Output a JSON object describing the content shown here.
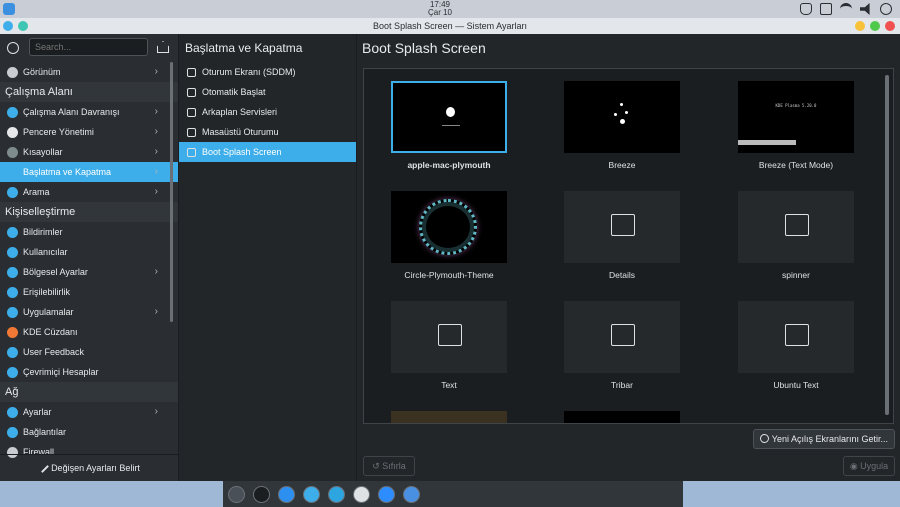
{
  "topbar": {
    "time": "17:49",
    "date": "Çar 10"
  },
  "window": {
    "title": "Boot Splash Screen — Sistem Ayarları"
  },
  "search": {
    "placeholder": "Search..."
  },
  "sidebar": {
    "items": [
      {
        "label": "Görünüm",
        "type": "item",
        "chevron": true,
        "icon": "appearance-icon"
      },
      {
        "label": "Çalışma Alanı",
        "type": "section"
      },
      {
        "label": "Çalışma Alanı Davranışı",
        "type": "item",
        "chevron": true,
        "icon": "workspace-icon"
      },
      {
        "label": "Pencere Yönetimi",
        "type": "item",
        "chevron": true,
        "icon": "window-icon"
      },
      {
        "label": "Kısayollar",
        "type": "item",
        "chevron": true,
        "icon": "keyboard-icon"
      },
      {
        "label": "Başlatma ve Kapatma",
        "type": "item",
        "chevron": true,
        "active": true,
        "icon": "startup-icon"
      },
      {
        "label": "Arama",
        "type": "item",
        "chevron": true,
        "icon": "search-icon"
      },
      {
        "label": "Kişiselleştirme",
        "type": "section"
      },
      {
        "label": "Bildirimler",
        "type": "item",
        "icon": "bell-icon"
      },
      {
        "label": "Kullanıcılar",
        "type": "item",
        "icon": "user-icon"
      },
      {
        "label": "Bölgesel Ayarlar",
        "type": "item",
        "chevron": true,
        "icon": "globe-icon"
      },
      {
        "label": "Erişilebilirlik",
        "type": "item",
        "icon": "accessibility-icon"
      },
      {
        "label": "Uygulamalar",
        "type": "item",
        "chevron": true,
        "icon": "apps-icon"
      },
      {
        "label": "KDE Cüzdanı",
        "type": "item",
        "icon": "wallet-icon"
      },
      {
        "label": "User Feedback",
        "type": "item",
        "icon": "feedback-icon"
      },
      {
        "label": "Çevrimiçi Hesaplar",
        "type": "item",
        "icon": "accounts-icon"
      },
      {
        "label": "Ağ",
        "type": "section"
      },
      {
        "label": "Ayarlar",
        "type": "item",
        "chevron": true,
        "icon": "settings-icon"
      },
      {
        "label": "Bağlantılar",
        "type": "item",
        "icon": "connections-icon"
      },
      {
        "label": "Firewall",
        "type": "item",
        "icon": "firewall-icon"
      }
    ],
    "footer_label": "Değişen Ayarları Belirt"
  },
  "middle": {
    "header": "Başlatma ve Kapatma",
    "items": [
      {
        "label": "Oturum Ekranı (SDDM)"
      },
      {
        "label": "Otomatik Başlat"
      },
      {
        "label": "Arkaplan Servisleri"
      },
      {
        "label": "Masaüstü Oturumu"
      },
      {
        "label": "Boot Splash Screen",
        "active": true
      }
    ]
  },
  "main": {
    "header": "Boot Splash Screen",
    "themes": [
      {
        "label": "apple-mac-plymouth",
        "selected": true,
        "thumb": "apple"
      },
      {
        "label": "Breeze",
        "thumb": "breeze"
      },
      {
        "label": "Breeze (Text Mode)",
        "thumb": "textmode",
        "thumb_text": "KDE Plasma 5.20.0"
      },
      {
        "label": "Circle-Plymouth-Theme",
        "thumb": "circle"
      },
      {
        "label": "Details",
        "thumb": "placeholder"
      },
      {
        "label": "spinner",
        "thumb": "placeholder"
      },
      {
        "label": "Text",
        "thumb": "placeholder"
      },
      {
        "label": "Tribar",
        "thumb": "placeholder"
      },
      {
        "label": "Ubuntu Text",
        "thumb": "placeholder"
      }
    ],
    "get_button": "Yeni Açılış Ekranlarını Getir...",
    "reset_button": "Sıfırla",
    "apply_button": "Uygula"
  },
  "dock": {
    "apps": [
      {
        "icon": "system-settings-icon",
        "color": "#4a5058"
      },
      {
        "icon": "terminal-icon",
        "color": "#1b1e20"
      },
      {
        "icon": "app-store-icon",
        "color": "#2d8ff0"
      },
      {
        "icon": "browser-icon",
        "color": "#3daee9"
      },
      {
        "icon": "telegram-icon",
        "color": "#2ca5e0"
      },
      {
        "icon": "obs-icon",
        "color": "#dfe2e5"
      },
      {
        "icon": "zoom-icon",
        "color": "#2d8cff"
      },
      {
        "icon": "chrome-icon",
        "color": "#4a90e2"
      }
    ]
  },
  "colors": {
    "accent": "#3daee9",
    "background": "#232629",
    "sidebar": "#2a2e32"
  }
}
